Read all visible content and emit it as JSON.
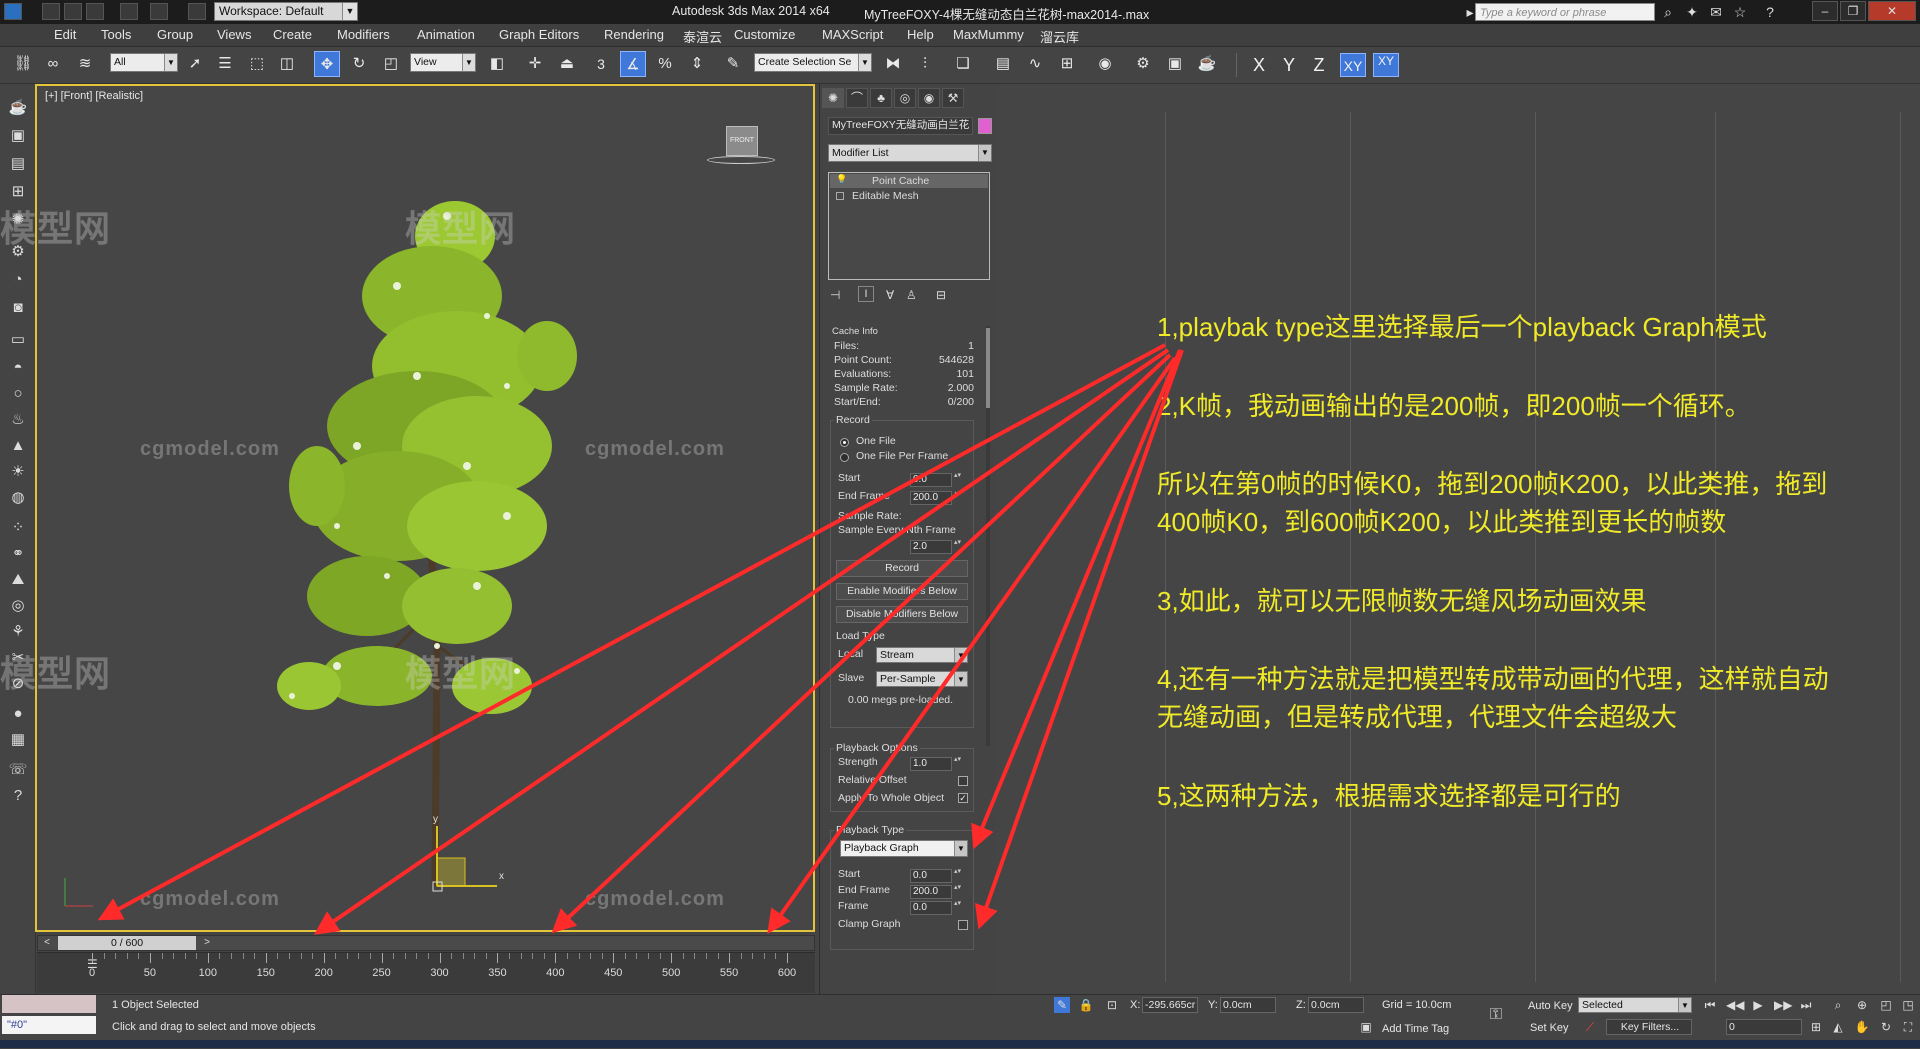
{
  "title_bar": {
    "workspace": "Workspace: Default",
    "app_title": "Autodesk 3ds Max  2014 x64",
    "file_title": "MyTreeFOXY-4棵无缝动态白兰花树-max2014-.max",
    "search_placeholder": "Type a keyword or phrase"
  },
  "menu": [
    "Edit",
    "Tools",
    "Group",
    "Views",
    "Create",
    "Modifiers",
    "Animation",
    "Graph Editors",
    "Rendering",
    "泰渲云",
    "Customize",
    "MAXScript",
    "Help",
    "MaxMummy",
    "溜云库"
  ],
  "toolbar": {
    "selection_filter": "All",
    "ref_coord": "View",
    "snap_label": "3",
    "selection_set": "Create Selection Se",
    "axes": [
      "X",
      "Y",
      "Z",
      "XY",
      "XY"
    ]
  },
  "viewport": {
    "label": "[+] [Front] [Realistic]",
    "viewcube_label": "FRONT",
    "watermark_cn": "模型网",
    "watermark_url": "cgmodel.com",
    "gizmo_x": "x",
    "gizmo_y": "y"
  },
  "timeline": {
    "slider_label": "0 / 600",
    "prev": "<",
    "next": ">",
    "ticks": [
      "0",
      "50",
      "100",
      "150",
      "200",
      "250",
      "300",
      "350",
      "400",
      "450",
      "500",
      "550",
      "600"
    ]
  },
  "command_panel": {
    "object_name": "MyTreeFOXY无缝动画白兰花",
    "object_color": "#e060d0",
    "modifier_list": "Modifier List",
    "stack": [
      "Point Cache",
      "Editable Mesh"
    ],
    "cache_info": {
      "title": "Cache Info",
      "rows": [
        {
          "label": "Files:",
          "value": "1"
        },
        {
          "label": "Point Count:",
          "value": "544628"
        },
        {
          "label": "Evaluations:",
          "value": "101"
        },
        {
          "label": "Sample Rate:",
          "value": "2.000"
        },
        {
          "label": "Start/End:",
          "value": "0/200"
        }
      ]
    },
    "record": {
      "title": "Record",
      "one_file": "One File",
      "one_file_per_frame": "One File Per Frame",
      "start_label": "Start",
      "start": "0.0",
      "end_label": "End Frame",
      "end": "200.0",
      "sample_rate": "Sample Rate:",
      "sample_every": "Sample Every Nth Frame",
      "sample_value": "2.0",
      "record_btn": "Record",
      "enable_btn": "Enable Modifiers Below",
      "disable_btn": "Disable Modifiers Below"
    },
    "load_type": {
      "title": "Load Type",
      "local_label": "Local",
      "local_value": "Stream",
      "slave_label": "Slave",
      "slave_value": "Per-Sample",
      "preloaded": "0.00 megs pre-loaded."
    },
    "playback_options": {
      "title": "Playback Options",
      "strength_label": "Strength",
      "strength": "1.0",
      "relative_offset": "Relative Offset",
      "apply_whole": "Apply To Whole Object"
    },
    "playback_type": {
      "title": "Playback Type",
      "value": "Playback Graph",
      "start_label": "Start",
      "start": "0.0",
      "end_label": "End Frame",
      "end": "200.0",
      "frame_label": "Frame",
      "frame": "0.0",
      "clamp": "Clamp Graph"
    }
  },
  "notes": [
    "1,playbak type这里选择最后一个playback Graph模式",
    "2,K帧，我动画输出的是200帧，即200帧一个循环。",
    "所以在第0帧的时候K0，拖到200帧K200，以此类推，拖到",
    "400帧K0，到600帧K200，以此类推到更长的帧数",
    "3,如此，就可以无限帧数无缝风场动画效果",
    "4,还有一种方法就是把模型转成带动画的代理，这样就自动",
    "无缝动画，但是转成代理，代理文件会超级大",
    "5,这两种方法，根据需求选择都是可行的"
  ],
  "status_bar": {
    "maxscript": "\"#0\"",
    "selected": "1 Object Selected",
    "prompt": "Click and drag to select and move objects",
    "x_label": "X:",
    "x": "-295.665cr",
    "y_label": "Y:",
    "y": "0.0cm",
    "z_label": "Z:",
    "z": "0.0cm",
    "grid": "Grid = 10.0cm",
    "add_time_tag": "Add Time Tag",
    "auto_key": "Auto Key",
    "set_key": "Set Key",
    "key_mode": "Selected",
    "key_filters": "Key Filters...",
    "frame": "0"
  },
  "colors": {
    "note_text": "#f0ea28",
    "arrow": "#ff2a2a",
    "viewport_border": "#e3c43a",
    "active_tool": "#3f78d8"
  }
}
